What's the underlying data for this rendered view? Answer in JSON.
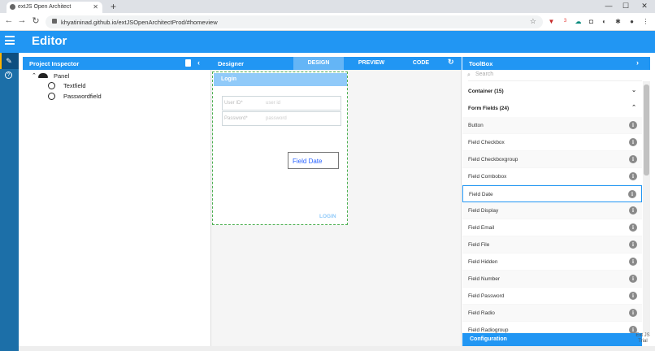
{
  "browser": {
    "tab_title": "extJS Open Architect",
    "url": "khyatininad.github.io/extJSOpenArchitectProd/#homeview",
    "ext_count": "3"
  },
  "app": {
    "title": "Editor"
  },
  "project_inspector": {
    "title": "Project Inspector",
    "tree": {
      "root": "Panel",
      "children": [
        "Textfield",
        "Passwordfield"
      ]
    }
  },
  "designer": {
    "title": "Designer",
    "tabs": [
      "DESIGN",
      "PREVIEW",
      "CODE"
    ],
    "form": {
      "title": "Login",
      "userid_label": "User ID*",
      "userid_placeholder": "user id",
      "password_label": "Password*",
      "password_placeholder": "password",
      "field_date_label": "Field Date",
      "login_button": "LOGIN"
    }
  },
  "toolbox": {
    "title": "ToolBox",
    "search_placeholder": "Search",
    "sections": [
      "Container (15)",
      "Form Fields (24)"
    ],
    "items": [
      "Button",
      "Field Checkbox",
      "Field Checkboxgroup",
      "Field Combobox",
      "Field Date",
      "Field Display",
      "Field Email",
      "Field File",
      "Field Hidden",
      "Field Number",
      "Field Password",
      "Field Radio",
      "Field Radiogroup"
    ],
    "selected": "Field Date",
    "config_label": "Configuration",
    "trial_text": "Ext JS Trial"
  }
}
